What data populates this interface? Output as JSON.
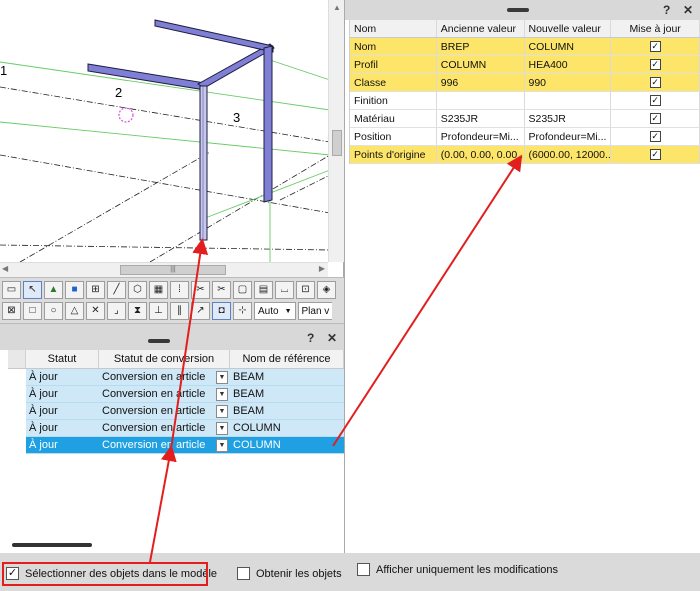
{
  "viewport": {
    "labels": [
      "1",
      "2",
      "3"
    ]
  },
  "toolbar": {
    "view_mode": "Auto",
    "view_plane": "Plan v"
  },
  "left_panel": {
    "columns": [
      "Statut",
      "Statut de conversion",
      "Nom de référence"
    ],
    "rows": [
      {
        "status": "À jour",
        "conversion": "Conversion en article",
        "ref": "BEAM",
        "selected": false
      },
      {
        "status": "À jour",
        "conversion": "Conversion en article",
        "ref": "BEAM",
        "selected": false
      },
      {
        "status": "À jour",
        "conversion": "Conversion en article",
        "ref": "BEAM",
        "selected": false
      },
      {
        "status": "À jour",
        "conversion": "Conversion en article",
        "ref": "COLUMN",
        "selected": false
      },
      {
        "status": "À jour",
        "conversion": "Conversion en article",
        "ref": "COLUMN",
        "selected": true
      }
    ],
    "help": "?",
    "close": "✕"
  },
  "right_panel": {
    "columns": [
      "Nom",
      "Ancienne valeur",
      "Nouvelle valeur",
      "Mise à jour"
    ],
    "rows": [
      {
        "name": "Nom",
        "old": "BREP",
        "new": "COLUMN",
        "checked": true,
        "highlight": true
      },
      {
        "name": "Profil",
        "old": "COLUMN",
        "new": "HEA400",
        "checked": true,
        "highlight": true
      },
      {
        "name": "Classe",
        "old": "996",
        "new": "990",
        "checked": true,
        "highlight": true
      },
      {
        "name": "Finition",
        "old": "",
        "new": "",
        "checked": true,
        "highlight": false
      },
      {
        "name": "Matériau",
        "old": "S235JR",
        "new": "S235JR",
        "checked": true,
        "highlight": false
      },
      {
        "name": "Position",
        "old": "Profondeur=Mi...",
        "new": "Profondeur=Mi...",
        "checked": true,
        "highlight": false
      },
      {
        "name": "Points d'origine",
        "old": "(0.00, 0.00, 0.00...",
        "new": "(6000.00, 12000...",
        "checked": true,
        "highlight": true
      }
    ],
    "help": "?",
    "close": "✕"
  },
  "bottom": {
    "select_objects_label": "Sélectionner des objets dans le modèle",
    "select_objects_checked": true,
    "get_objects_label": "Obtenir les objets",
    "get_objects_checked": false,
    "only_changes_label": "Afficher uniquement les modifications",
    "only_changes_checked": false
  },
  "colors": {
    "highlight_row": "#fde569",
    "selected_row": "#1fa0e3",
    "row_bg": "#cfe8f7",
    "annotation_red": "#e31e1e"
  }
}
